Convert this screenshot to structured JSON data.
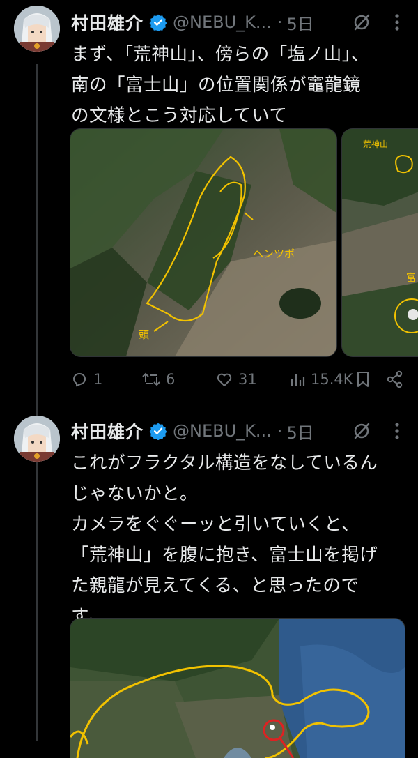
{
  "tweets": [
    {
      "author": {
        "name": "村田雄介",
        "handle": "@NEBU_K...",
        "time": "5日"
      },
      "text": "まず、「荒神山」、傍らの「塩ノ山」、\n南の「富士山」の位置関係が竈龍鏡\nの文様とこう対応していて",
      "media_annotations": {
        "left_label1": "ヘンツポ",
        "left_label2": "頭",
        "right_label1": "荒神山",
        "right_label2": "富"
      },
      "metrics": {
        "replies": "1",
        "reposts": "6",
        "likes": "31",
        "views": "15.4K"
      }
    },
    {
      "author": {
        "name": "村田雄介",
        "handle": "@NEBU_K...",
        "time": "5日"
      },
      "text": "これがフラクタル構造をなしているん\nじゃないかと。\nカメラをぐぐーッと引いていくと、\n「荒神山」を腹に抱き、富士山を掲げ\nた親龍が見えてくる、と思ったので\nす。"
    }
  ],
  "icons": {
    "verified": "verified-badge-icon",
    "grok": "grok-slash-icon",
    "more": "more-vertical-icon",
    "reply": "reply-icon",
    "repost": "repost-icon",
    "like": "like-icon",
    "views": "views-icon",
    "bookmark": "bookmark-icon",
    "share": "share-icon"
  },
  "colors": {
    "background": "#000000",
    "text": "#e7e9ea",
    "secondary": "#71767b",
    "verified": "#1d9bf0",
    "annotation": "#f2c200"
  }
}
